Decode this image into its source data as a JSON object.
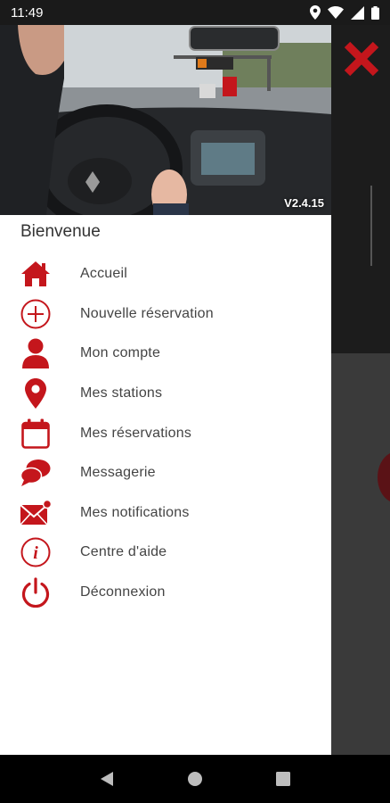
{
  "status_bar": {
    "time": "11:49"
  },
  "hero": {
    "version": "V2.4.15"
  },
  "drawer": {
    "welcome": "Bienvenue"
  },
  "menu": [
    {
      "label": "Accueil",
      "icon": "home-icon"
    },
    {
      "label": "Nouvelle réservation",
      "icon": "plus-circle-icon"
    },
    {
      "label": "Mon compte",
      "icon": "user-icon"
    },
    {
      "label": "Mes stations",
      "icon": "map-pin-icon"
    },
    {
      "label": "Mes réservations",
      "icon": "calendar-icon"
    },
    {
      "label": "Messagerie",
      "icon": "chat-icon"
    },
    {
      "label": "Mes notifications",
      "icon": "mail-notification-icon"
    },
    {
      "label": "Centre d'aide",
      "icon": "info-icon"
    },
    {
      "label": "Déconnexion",
      "icon": "power-icon"
    }
  ],
  "colors": {
    "accent": "#c4161c",
    "text": "#444444"
  }
}
